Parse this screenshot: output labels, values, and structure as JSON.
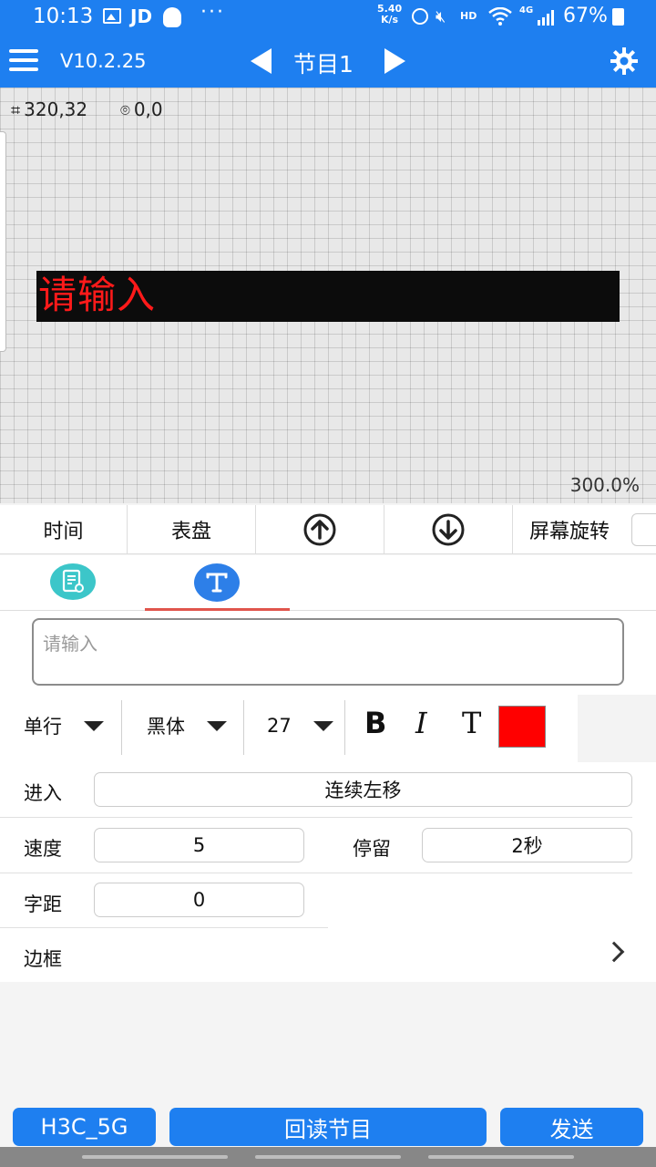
{
  "status_bar": {
    "time": "10:13",
    "jd_label": "JD",
    "more": "···",
    "net_speed": "5.40",
    "net_unit": "K/s",
    "hd": "HD",
    "network": "4G",
    "battery": "67%"
  },
  "app_bar": {
    "version": "V10.2.25",
    "program_title": "节目1",
    "icons": [
      "menu-icon",
      "prev-arrow-icon",
      "next-arrow-icon",
      "gear-icon"
    ]
  },
  "canvas": {
    "size_readout": "320,32",
    "position_readout": "0,0",
    "led_text": "请输入",
    "led_text_color": "#ff1a1a",
    "zoom": "300.0%"
  },
  "toolbar": {
    "time_label": "时间",
    "dial_label": "表盘",
    "move_up_icon": "arrow-up-circle-icon",
    "move_down_icon": "arrow-down-circle-icon",
    "rotate_label": "屏幕旋转"
  },
  "tabs": [
    "document-settings-icon",
    "text-icon"
  ],
  "text_editor": {
    "placeholder": "请输入",
    "line_mode": "单行",
    "font": "黑体",
    "font_size": "27",
    "bold": "B",
    "italic": "I",
    "text_t": "T",
    "color": "#ff0000"
  },
  "form": {
    "enter_label": "进入",
    "enter_value": "连续左移",
    "speed_label": "速度",
    "speed_value": "5",
    "stay_label": "停留",
    "stay_value": "2秒",
    "spacing_label": "字距",
    "spacing_value": "0",
    "border_label": "边框"
  },
  "bottom": {
    "wifi_button": "H3C_5G",
    "readback_button": "回读节目",
    "send_button": "发送"
  },
  "colors": {
    "primary": "#1e7ff0",
    "tab_indicator": "#e0554c"
  }
}
